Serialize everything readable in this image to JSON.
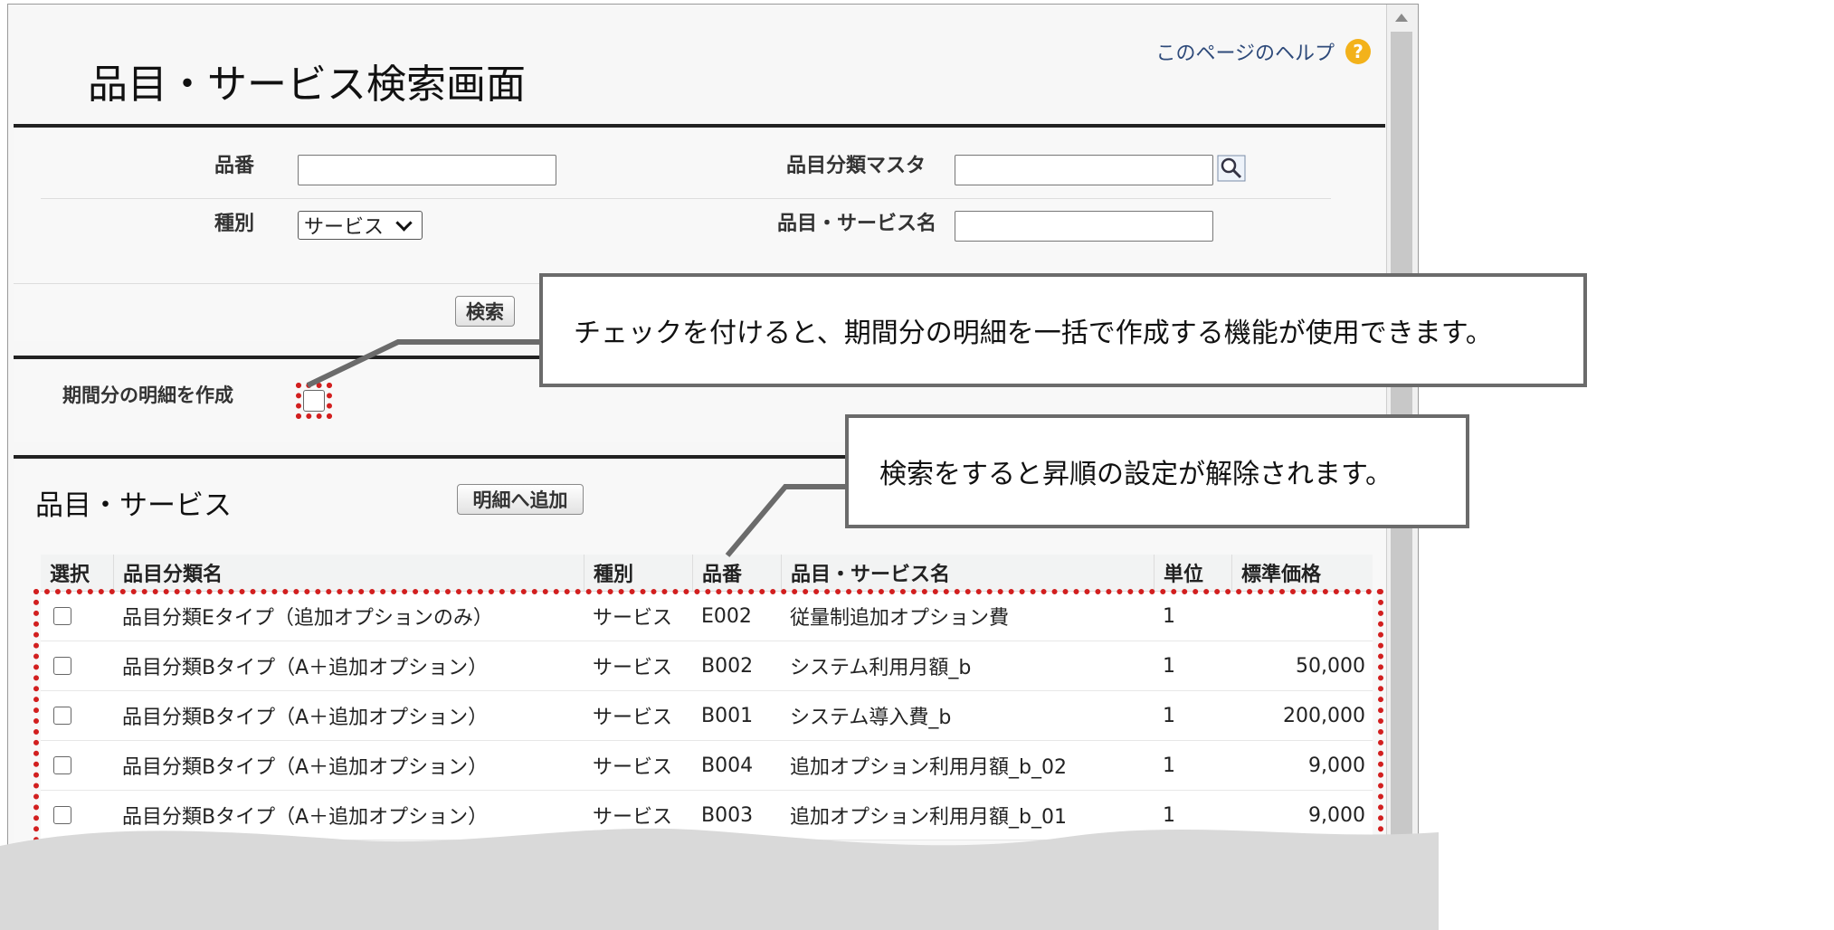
{
  "page": {
    "title": "品目・サービス検索画面",
    "help_link": "このページのヘルプ",
    "help_icon": "help-question-icon"
  },
  "search_form": {
    "item_code_label": "品番",
    "item_code_value": "",
    "type_label": "種別",
    "type_selected": "サービス",
    "category_master_label": "品目分類マスタ",
    "category_master_value": "",
    "item_service_name_label": "品目・サービス名",
    "item_service_name_value": "",
    "search_button": "検索"
  },
  "period_section": {
    "label": "期間分の明細を作成",
    "checked": false
  },
  "results": {
    "section_title": "品目・サービス",
    "add_button": "明細へ追加",
    "columns": [
      "選択",
      "品目分類名",
      "種別",
      "品番",
      "品目・サービス名",
      "単位",
      "標準価格"
    ],
    "rows": [
      {
        "category": "品目分類Eタイプ（追加オプションのみ）",
        "type": "サービス",
        "code": "E002",
        "name": "従量制追加オプション費",
        "unit": "1",
        "price": ""
      },
      {
        "category": "品目分類Bタイプ（A＋追加オプション）",
        "type": "サービス",
        "code": "B002",
        "name": "システム利用月額_b",
        "unit": "1",
        "price": "50,000"
      },
      {
        "category": "品目分類Bタイプ（A＋追加オプション）",
        "type": "サービス",
        "code": "B001",
        "name": "システム導入費_b",
        "unit": "1",
        "price": "200,000"
      },
      {
        "category": "品目分類Bタイプ（A＋追加オプション）",
        "type": "サービス",
        "code": "B004",
        "name": "追加オプション利用月額_b_02",
        "unit": "1",
        "price": "9,000"
      },
      {
        "category": "品目分類Bタイプ（A＋追加オプション）",
        "type": "サービス",
        "code": "B003",
        "name": "追加オプション利用月額_b_01",
        "unit": "1",
        "price": "9,000"
      }
    ]
  },
  "callouts": {
    "period_note": "チェックを付けると、期間分の明細を一括で作成する機能が使用できます。",
    "sort_note": "検索をすると昇順の設定が解除されます。"
  },
  "colors": {
    "highlight": "#d21f1f",
    "callout_border": "#6b6b6b",
    "help_icon": "#f3b21b"
  }
}
